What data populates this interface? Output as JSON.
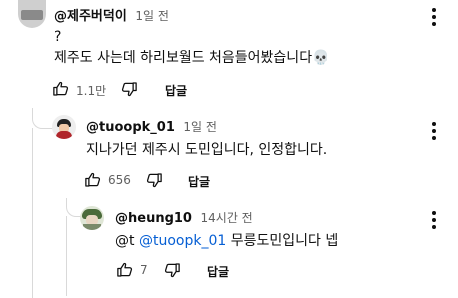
{
  "comments": [
    {
      "author": "@제주버덕이",
      "time": "1일 전",
      "lines": [
        "?",
        "제주도 사는데 하리보월드 처음들어봤습니다💀"
      ],
      "likes": "1.1만",
      "reply_label": "답글"
    },
    {
      "author": "@tuoopk_01",
      "time": "1일 전",
      "text": "지나가던 제주시 도민입니다, 인정합니다.",
      "likes": "656",
      "reply_label": "답글"
    },
    {
      "author": "@heung10",
      "time": "14시간 전",
      "mention_prefix": "@t",
      "mention": "@tuoopk_01",
      "text_rest": "무릉도민입니다 넵",
      "likes": "7",
      "reply_label": "답글"
    }
  ],
  "icons": {
    "like": "thumb-up-icon",
    "dislike": "thumb-down-icon",
    "more": "more-vert-icon"
  },
  "colors": {
    "mention": "#065fd4",
    "secondary_text": "#606060"
  }
}
